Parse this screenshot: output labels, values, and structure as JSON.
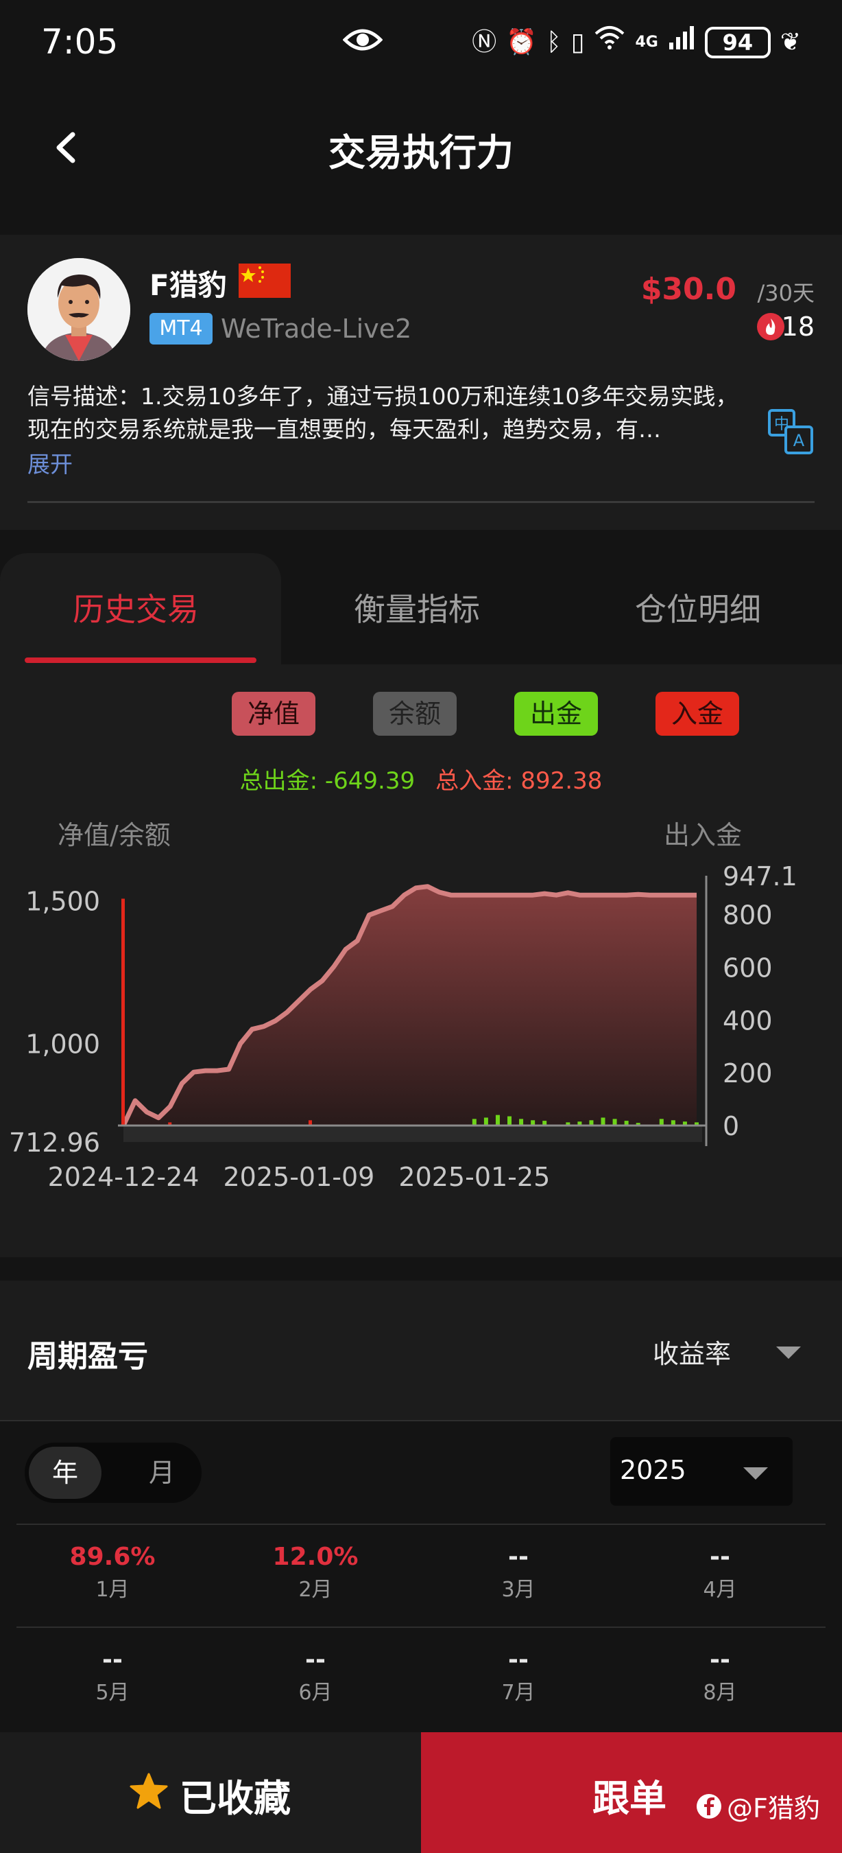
{
  "status": {
    "time": "7:05",
    "network": "4G",
    "battery": "94"
  },
  "header": {
    "title": "交易执行力"
  },
  "provider": {
    "name": "F猎豹",
    "platform": "MT4",
    "server": "WeTrade-Live2",
    "price": "$30.0",
    "period": "/30天",
    "hot_count": "18",
    "description": "信号描述：1.交易10多年了，通过亏损100万和连续10多年交易实践，现在的交易系统就是我一直想要的，每天盈利，趋势交易，有…",
    "expand_label": "展开"
  },
  "tabs": [
    "历史交易",
    "衡量指标",
    "仓位明细"
  ],
  "legend": {
    "equity": "净值",
    "balance": "余额",
    "withdraw": "出金",
    "deposit": "入金"
  },
  "totals": {
    "withdraw_label": "总出金: -649.39",
    "deposit_label": "总入金: 892.38"
  },
  "colors": {
    "accent": "#d0202e",
    "equity": "#c8515a",
    "withdraw": "#6ed41a",
    "deposit": "#e3271a"
  },
  "chart_data": {
    "type": "area",
    "left_axis_label": "净值/余额",
    "right_axis_label": "出入金",
    "left_ticks": [
      "1,500",
      "1,000",
      "712.96"
    ],
    "left_ylim": [
      712.96,
      1530
    ],
    "right_ticks": [
      "947.1",
      "800",
      "600",
      "400",
      "200",
      "0"
    ],
    "right_ylim": [
      0,
      947.1
    ],
    "x_ticks": [
      "2024-12-24",
      "2025-01-09",
      "2025-01-25"
    ],
    "series": [
      {
        "name": "净值",
        "values": [
          712.96,
          800,
          760,
          740,
          780,
          860,
          900,
          905,
          905,
          910,
          1000,
          1050,
          1060,
          1080,
          1110,
          1150,
          1190,
          1220,
          1270,
          1330,
          1360,
          1450,
          1465,
          1480,
          1520,
          1545,
          1550,
          1530,
          1520,
          1520,
          1520,
          1520,
          1520,
          1520,
          1520,
          1520,
          1525,
          1520,
          1528,
          1520,
          1520,
          1520,
          1520,
          1520,
          1522,
          1520,
          1520,
          1520,
          1520,
          1520
        ]
      },
      {
        "name": "出金",
        "values": [
          0,
          0,
          0,
          0,
          0,
          0,
          0,
          0,
          0,
          0,
          0,
          0,
          0,
          0,
          0,
          0,
          0,
          0,
          0,
          0,
          0,
          0,
          0,
          0,
          0,
          0,
          0,
          0,
          0,
          0,
          25,
          30,
          40,
          35,
          25,
          20,
          18,
          0,
          12,
          15,
          20,
          30,
          25,
          18,
          10,
          0,
          25,
          20,
          15,
          12
        ]
      },
      {
        "name": "入金",
        "values": [
          860,
          0,
          0,
          0,
          12,
          0,
          0,
          0,
          0,
          0,
          0,
          0,
          0,
          0,
          0,
          0,
          20,
          0,
          0,
          0,
          0,
          0,
          0,
          0,
          0,
          0,
          0,
          0,
          0,
          0,
          0,
          0,
          0,
          0,
          0,
          0,
          0,
          0,
          0,
          0,
          0,
          0,
          0,
          0,
          0,
          0,
          0,
          0,
          0,
          0
        ]
      }
    ]
  },
  "period_pl": {
    "title": "周期盈亏",
    "metric": "收益率",
    "seg_year": "年",
    "seg_month": "月",
    "year": "2025",
    "months": [
      {
        "value": "89.6%",
        "name": "1月",
        "positive": true
      },
      {
        "value": "12.0%",
        "name": "2月",
        "positive": true
      },
      {
        "value": "--",
        "name": "3月",
        "positive": false
      },
      {
        "value": "--",
        "name": "4月",
        "positive": false
      },
      {
        "value": "--",
        "name": "5月",
        "positive": false
      },
      {
        "value": "--",
        "name": "6月",
        "positive": false
      },
      {
        "value": "--",
        "name": "7月",
        "positive": false
      },
      {
        "value": "--",
        "name": "8月",
        "positive": false
      }
    ]
  },
  "bottom": {
    "favorite_label": "已收藏",
    "follow_label": "跟单",
    "watermark": "@F猎豹"
  }
}
